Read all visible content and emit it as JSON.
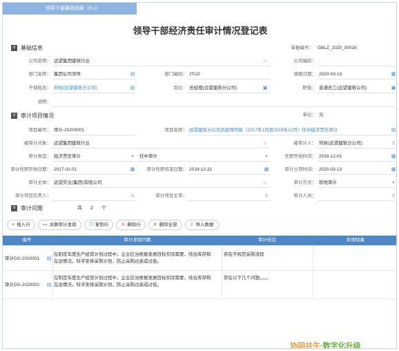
{
  "tab": "领导干部廉政档案（6-1）",
  "title": "领导干部经济责任审计情况登记表",
  "doc_no": {
    "label": "单据编号：",
    "value": "GBLZ_2020_00016"
  },
  "sections": {
    "basic": "基础信息",
    "project": "审计项目情况",
    "issues": "审计问题"
  },
  "basic": {
    "company_name": {
      "label": "公司名称：",
      "value": "远望集团建筑行业"
    },
    "company_code": {
      "label": "公司编码：",
      "value": ""
    },
    "dept_name": {
      "label": "部门名称：",
      "value": "集团公司领导"
    },
    "dept_code": {
      "label": "部门编码：",
      "value": "JTLD"
    },
    "fill_date": {
      "label": "填报日期：",
      "value": "2020-03-13"
    },
    "cadre_name": {
      "label": "干部姓名：",
      "value": "何侯(远望建筑分公司)"
    },
    "position": {
      "label": "岗位：",
      "value": "总经理(远望建筑分公司)"
    },
    "rank": {
      "label": "职级：",
      "value": "普通员工(远望建筑公司)"
    },
    "note": {
      "label": "说明：",
      "value": ""
    }
  },
  "unit": {
    "label": "单位：",
    "value": "元"
  },
  "project": {
    "proj_no": {
      "label": "项目编号：",
      "value": "审计-20200001"
    },
    "proj_name": {
      "label": "项目名称：",
      "value": "远望建筑分公司总经理何侯（2017年1月至2019年12月）任中经济责任审计"
    },
    "audited_obj": {
      "label": "被审计对象：",
      "value": "远望集团建筑行业"
    },
    "audited_person": {
      "label": "被审计人：",
      "value": "何侯(远望建筑分公司)"
    },
    "audit_type": {
      "label": "审计类型：",
      "value": "经济责任审计"
    },
    "audit_sub": {
      "value": "任中审计"
    },
    "start_date": {
      "label": "任职开始时间：",
      "value": "2016-12-01"
    },
    "audit_begin": {
      "label": "审计任职开始日期：",
      "value": "2017-01-01"
    },
    "audit_end": {
      "label": "审计任职结束日期：",
      "value": "2019-12-31"
    },
    "setup_date": {
      "label": "审计立项时间：",
      "value": "2020-03-13"
    },
    "audit_subject": {
      "label": "审计主体：",
      "value": "远望实业(集团)有限公司"
    },
    "audit_method": {
      "label": "审计方式：",
      "value": "就地审计"
    },
    "proj_leader": {
      "label": "审计项目负责人：",
      "value": ""
    },
    "proj_owner": {
      "label": "审计项目主审：",
      "value": ""
    },
    "auditor": {
      "label": "审计人员：",
      "value": ""
    }
  },
  "issues": {
    "count_prefix": "共",
    "count": "2",
    "count_suffix": "个"
  },
  "toolbar": {
    "insert": "插入行",
    "link": "关联审计发现",
    "copy": "复制行",
    "delete": "删除行",
    "delete_all": "删除全部",
    "import": "导入数据"
  },
  "table": {
    "headers": [
      "编号",
      "审计发现问题",
      "审计结论",
      "处理结果"
    ],
    "rows": [
      {
        "id": "审计DG-2020001",
        "finding_1": "在制定年度生产经营计划过程中，企业应当根据发展目标实际需要，结合库存和",
        "finding_2": "在途情况，科学安排采购计划，防止采购过高或过低。",
        "conclusion": "存在不规范采购流程",
        "result": ""
      },
      {
        "id": "审计DG-2020002",
        "finding_1": "在制定年度生产经营计划过程中，企业应当根据发展目标实际需要，结合库存和",
        "finding_2": "在途情况，科学安排采购计划，防止采购过高或过低。",
        "conclusion": "存在以下几个问题。。。。",
        "result": ""
      }
    ]
  },
  "footer": {
    "part1": "协同共生",
    "dot": "·",
    "part2": "数字化升级"
  },
  "colors": {
    "tab": "#8fb4e3",
    "header": "#4d87c7",
    "link": "#3a87d6"
  }
}
